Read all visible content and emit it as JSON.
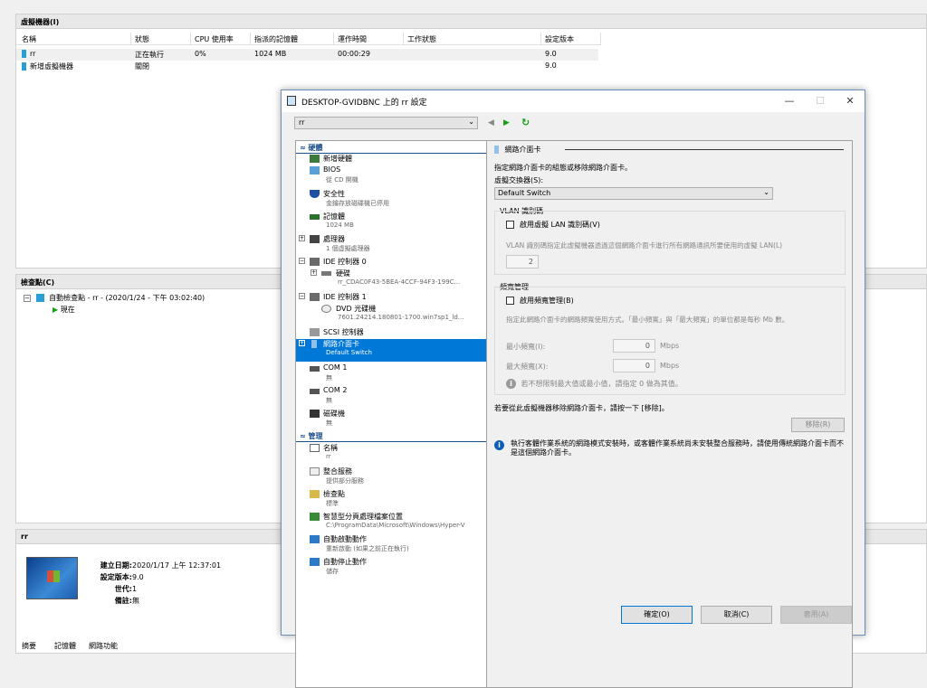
{
  "vm_panel": {
    "title": "虛擬機器(I)",
    "columns": [
      "名稱",
      "狀態",
      "CPU 使用率",
      "指派的記憶體",
      "運作時間",
      "工作狀態",
      "設定版本"
    ],
    "rows": [
      {
        "name": "rr",
        "state": "正在執行",
        "cpu": "0%",
        "mem": "1024 MB",
        "uptime": "00:00:29",
        "status": "",
        "version": "9.0"
      },
      {
        "name": "新增虛擬機器",
        "state": "關閉",
        "cpu": "",
        "mem": "",
        "uptime": "",
        "status": "",
        "version": "9.0"
      }
    ]
  },
  "checkpoint_panel": {
    "title": "檢查點(C)",
    "root": "自動檢查點 - rr - (2020/1/24 - 下午 03:02:40)",
    "child": "現在"
  },
  "details_panel": {
    "title": "rr",
    "labels": {
      "created": "建立日期:",
      "version": "設定版本:",
      "generation": "世代:",
      "notes": "備註:"
    },
    "values": {
      "created": "2020/1/17 上午 12:37:01",
      "version": "9.0",
      "generation": "1",
      "notes": "無"
    },
    "tabs": [
      "摘要",
      "記憶體",
      "網路功能"
    ]
  },
  "dialog": {
    "title": "DESKTOP-GVIDBNC 上的 rr 設定",
    "vm_select": "rr",
    "tree": {
      "hardware_header": "硬體",
      "management_header": "管理",
      "items": [
        {
          "label": "新增硬體",
          "sub": ""
        },
        {
          "label": "BIOS",
          "sub": "從 CD 開機"
        },
        {
          "label": "安全性",
          "sub": "金鑰存放磁碟機已停用"
        },
        {
          "label": "記憶體",
          "sub": "1024 MB"
        },
        {
          "label": "處理器",
          "sub": "1 個虛擬處理器"
        },
        {
          "label": "IDE 控制器 0",
          "sub": ""
        },
        {
          "label": "硬碟",
          "sub": "rr_CDAC0F43-5BEA-4CCF-94F3-199C..."
        },
        {
          "label": "IDE 控制器 1",
          "sub": ""
        },
        {
          "label": "DVD 光碟機",
          "sub": "7601.24214.180801-1700.win7sp1_ld..."
        },
        {
          "label": "SCSI 控制器",
          "sub": ""
        },
        {
          "label": "網路介面卡",
          "sub": "Default Switch"
        },
        {
          "label": "COM 1",
          "sub": "無"
        },
        {
          "label": "COM 2",
          "sub": "無"
        },
        {
          "label": "磁碟機",
          "sub": "無"
        }
      ],
      "mgmt_items": [
        {
          "label": "名稱",
          "sub": "rr"
        },
        {
          "label": "整合服務",
          "sub": "提供部分服務"
        },
        {
          "label": "檢查點",
          "sub": "標準"
        },
        {
          "label": "智慧型分頁處理檔案位置",
          "sub": "C:\\ProgramData\\Microsoft\\Windows\\Hyper-V"
        },
        {
          "label": "自動啟動動作",
          "sub": "重新啟動 (如果之前正在執行)"
        },
        {
          "label": "自動停止動作",
          "sub": "儲存"
        }
      ]
    },
    "nic": {
      "heading": "網路介面卡",
      "desc": "指定網路介面卡的組態或移除網路介面卡。",
      "switch_label": "虛擬交換器(S):",
      "switch_value": "Default Switch",
      "vlan_title": "VLAN 識別碼",
      "vlan_check": "啟用虛擬 LAN 識別碼(V)",
      "vlan_desc": "VLAN 識別碼指定此虛擬機器透過這個網路介面卡進行所有網路通訊所要使用的虛擬 LAN(L)",
      "vlan_value": "2",
      "bw_title": "頻寬管理",
      "bw_check": "啟用頻寬管理(B)",
      "bw_desc": "指定此網路介面卡的網路頻寬使用方式。「最小頻寬」與「最大頻寬」的單位都是每秒 Mb 數。",
      "min_label": "最小頻寬(I):",
      "max_label": "最大頻寬(X):",
      "min_value": "0",
      "max_value": "0",
      "unit": "Mbps",
      "bw_note": "若不想限制最大值或最小值，請指定 0 做為其值。",
      "remove_text": "若要從此虛擬機器移除網路介面卡，請按一下 [移除]。",
      "remove_btn": "移除(R)",
      "legacy_note": "執行客體作業系統的網路模式安裝時，或客體作業系統尚未安裝整合服務時，請使用傳統網路介面卡而不是這個網路介面卡。"
    },
    "buttons": {
      "ok": "確定(O)",
      "cancel": "取消(C)",
      "apply": "套用(A)"
    }
  }
}
